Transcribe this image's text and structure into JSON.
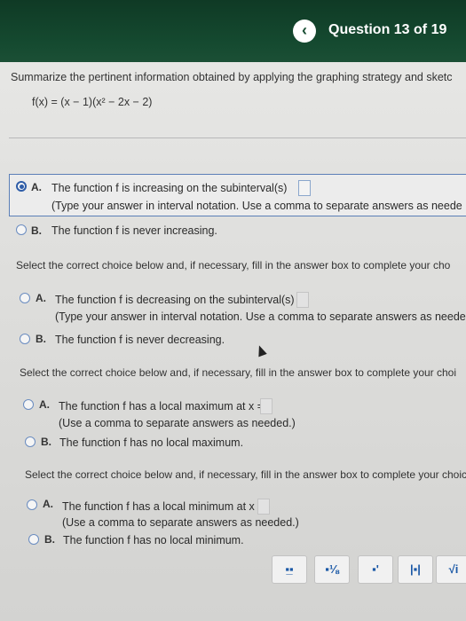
{
  "header": {
    "back_icon": "chevron-left-icon",
    "title": "Question 13 of 19"
  },
  "question": {
    "instruction": "Summarize the pertinent information obtained by applying the graphing strategy and sketc",
    "formula": "f(x) = (x − 1)(x² − 2x − 2)"
  },
  "group1": {
    "choiceA_letter": "A.",
    "choiceA_text": "The function f is increasing on the subinterval(s)",
    "choiceA_hint": "(Type your answer in interval notation. Use a comma to separate answers as neede",
    "choiceB_letter": "B.",
    "choiceB_text": "The function f is never increasing."
  },
  "group2": {
    "prompt": "Select the correct choice below and, if necessary, fill in the answer box to complete your cho",
    "choiceA_letter": "A.",
    "choiceA_text": "The function f is decreasing on the subinterval(s)",
    "choiceA_hint": "(Type your answer in interval notation. Use a comma to separate answers as neede",
    "choiceB_letter": "B.",
    "choiceB_text": "The function f is never decreasing."
  },
  "group3": {
    "prompt": "Select the correct choice below and, if necessary, fill in the answer box to complete your choi",
    "choiceA_letter": "A.",
    "choiceA_text": "The function f has a local maximum at x =",
    "choiceA_hint": "(Use a comma to separate answers as needed.)",
    "choiceB_letter": "B.",
    "choiceB_text": "The function f has no local maximum."
  },
  "group4": {
    "prompt": "Select the correct choice below and, if necessary, fill in the answer box to complete your choic",
    "choiceA_letter": "A.",
    "choiceA_text": "The function f has a local minimum at x =",
    "choiceA_hint": "(Use a comma to separate answers as needed.)",
    "choiceB_letter": "B.",
    "choiceB_text": "The function f has no local minimum."
  },
  "toolbar": {
    "fraction": "▪̲▪",
    "mixed": "▪⅛",
    "exponent": "▪'",
    "abs": "|▪|",
    "sqrt": "√i"
  },
  "colors": {
    "header": "#154a30",
    "selection": "#2f5da8"
  }
}
